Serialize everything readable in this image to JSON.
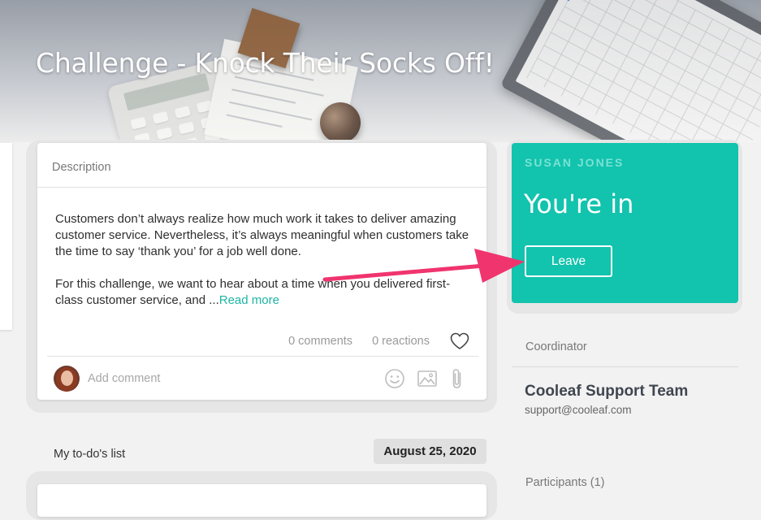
{
  "hero": {
    "title": "Challenge - Knock Their Socks Off!"
  },
  "description": {
    "header": "Description",
    "paragraph_1": "Customers don’t always realize how much work it takes to deliver amazing customer service. Nevertheless, it’s always meaningful when customers take the time to say ‘thank you’ for a job well done.",
    "paragraph_2": "For this challenge, we want to hear about a time when you delivered first-class customer service, and ...",
    "read_more": "Read more",
    "comments_count": "0 comments",
    "reactions_count": "0 reactions",
    "add_comment_placeholder": "Add comment"
  },
  "todo": {
    "title": "My to-do's list",
    "date": "August 25, 2020"
  },
  "join_card": {
    "user_name": "SUSAN JONES",
    "status": "You're in",
    "leave_label": "Leave",
    "background_color": "#12c3ad"
  },
  "coordinator": {
    "label": "Coordinator",
    "name": "Cooleaf Support Team",
    "email": "support@cooleaf.com"
  },
  "participants": {
    "label": "Participants (1)"
  },
  "annotation": {
    "arrow_color": "#f0346e"
  },
  "icons": [
    "heart-icon",
    "emoji-icon",
    "image-icon",
    "paperclip-icon"
  ],
  "accent_color": "#1db5a5"
}
